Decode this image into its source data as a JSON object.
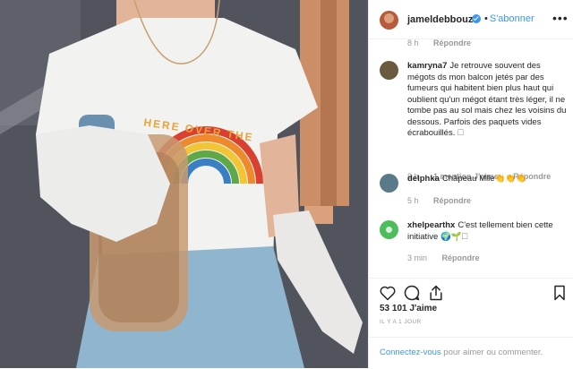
{
  "post": {
    "username": "jameldebbouze",
    "follow_label": "S'abonner",
    "follow_dot": "•",
    "more_icon": "•••"
  },
  "photo": {
    "shirt_text": "HERE OVER THE"
  },
  "comments": {
    "top_meta": {
      "time": "8 h",
      "reply": "Répondre"
    },
    "items": [
      {
        "username": "kamryna7",
        "text": "Je retrouve souvent des mégots ds mon balcon jetés par des fumeurs qui habitent bien plus haut qui oublient qu'un mégot étant très léger, il ne tombe pas au sol mais chez les voisins du dessous. Parfois des paquets vides écrabouillés. 🗆",
        "time": "8 h",
        "likes": "1 mention J'aime",
        "reply": "Répondre",
        "avatar_color": "#6a5a40"
      },
      {
        "username": "delphka",
        "text": "Châpeau Mlle👏👏👏",
        "time": "5 h",
        "reply": "Répondre",
        "avatar_color": "#5a7a8a"
      },
      {
        "username": "xhelpearthx",
        "text": "C'est tellement bien cette initiative 🌍🌱🗆",
        "time": "3 min",
        "reply": "Répondre",
        "avatar_color": "#4dbd5c"
      }
    ]
  },
  "footer": {
    "likes": "53 101 J'aime",
    "date": "IL Y A 1 JOUR",
    "login_link": "Connectez-vous",
    "login_text": " pour aimer ou commenter."
  },
  "colors": {
    "accent": "#3897f0",
    "text": "#262626",
    "muted": "#999999",
    "divider": "#efefef"
  }
}
